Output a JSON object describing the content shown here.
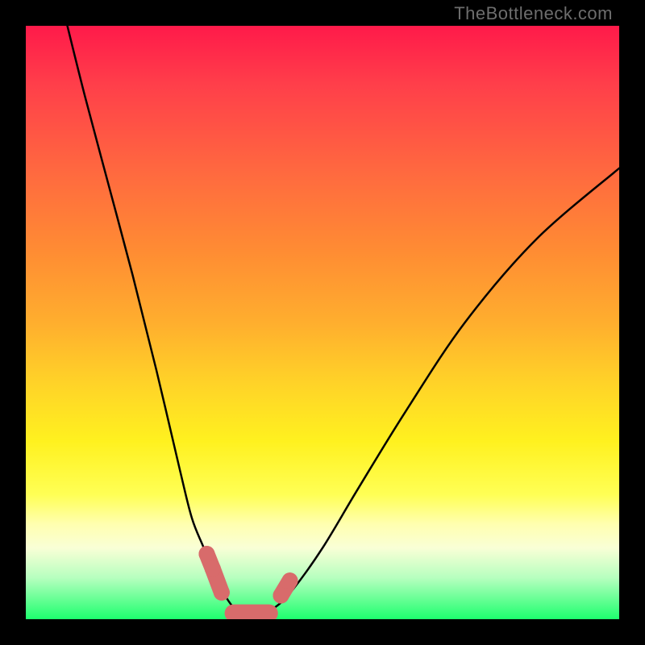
{
  "watermark": "TheBottleneck.com",
  "chart_data": {
    "type": "line",
    "title": "",
    "xlabel": "",
    "ylabel": "",
    "xlim": [
      0,
      100
    ],
    "ylim": [
      0,
      100
    ],
    "series": [
      {
        "name": "left-curve",
        "x": [
          7,
          10,
          14,
          18,
          22,
          26,
          28,
          30,
          32,
          33,
          35,
          38
        ],
        "y": [
          100,
          88,
          73,
          58,
          42,
          25,
          17,
          12,
          7,
          5,
          2,
          0
        ]
      },
      {
        "name": "right-curve",
        "x": [
          38,
          42,
          45,
          50,
          56,
          64,
          74,
          86,
          100
        ],
        "y": [
          0,
          2,
          5,
          12,
          22,
          35,
          50,
          64,
          76
        ]
      }
    ],
    "markers": [
      {
        "x": 30.5,
        "y": 11
      },
      {
        "x": 31.5,
        "y": 8.5
      },
      {
        "x": 33.0,
        "y": 4.5
      },
      {
        "x": 43.0,
        "y": 4.0
      },
      {
        "x": 44.5,
        "y": 6.5
      }
    ],
    "flat_region": {
      "x_from": 35,
      "x_to": 41,
      "y": 1
    }
  }
}
